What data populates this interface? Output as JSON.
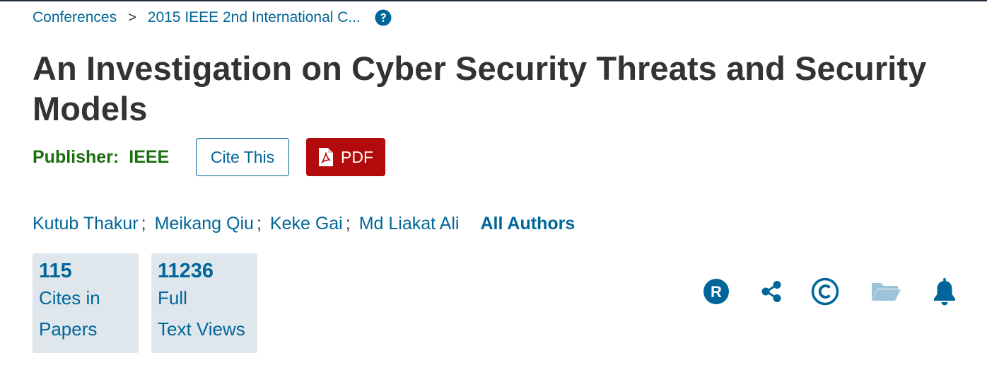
{
  "breadcrumb": {
    "items": [
      "Conferences",
      "2015 IEEE 2nd International C..."
    ],
    "separator": ">",
    "help_icon": "question-circle-icon"
  },
  "article": {
    "title": "An Investigation on Cyber Security Threats and Security Models",
    "publisher_label": "Publisher:",
    "publisher_name": "IEEE"
  },
  "buttons": {
    "cite_label": "Cite This",
    "pdf_label": "PDF",
    "pdf_icon": "pdf-file-icon"
  },
  "authors": {
    "names": [
      "Kutub Thakur",
      "Meikang Qiu",
      "Keke Gai",
      "Md Liakat Ali"
    ],
    "separator": ";",
    "all_authors_label": "All Authors"
  },
  "metrics": {
    "cites": {
      "value": "115",
      "label_line1": "Cites in",
      "label_line2": "Papers"
    },
    "views": {
      "value": "11236",
      "label_line1": "Full",
      "label_line2": "Text Views"
    }
  },
  "actions": {
    "icons": [
      "rights-permissions-icon",
      "share-icon",
      "copyright-icon",
      "folder-icon",
      "bell-icon"
    ]
  },
  "colors": {
    "link": "#006699",
    "title": "#333333",
    "publisher": "#1a6e0e",
    "pdf_button": "#b30b0b",
    "metric_bg": "#dfe6ec",
    "folder_icon": "#9cc3d9"
  }
}
